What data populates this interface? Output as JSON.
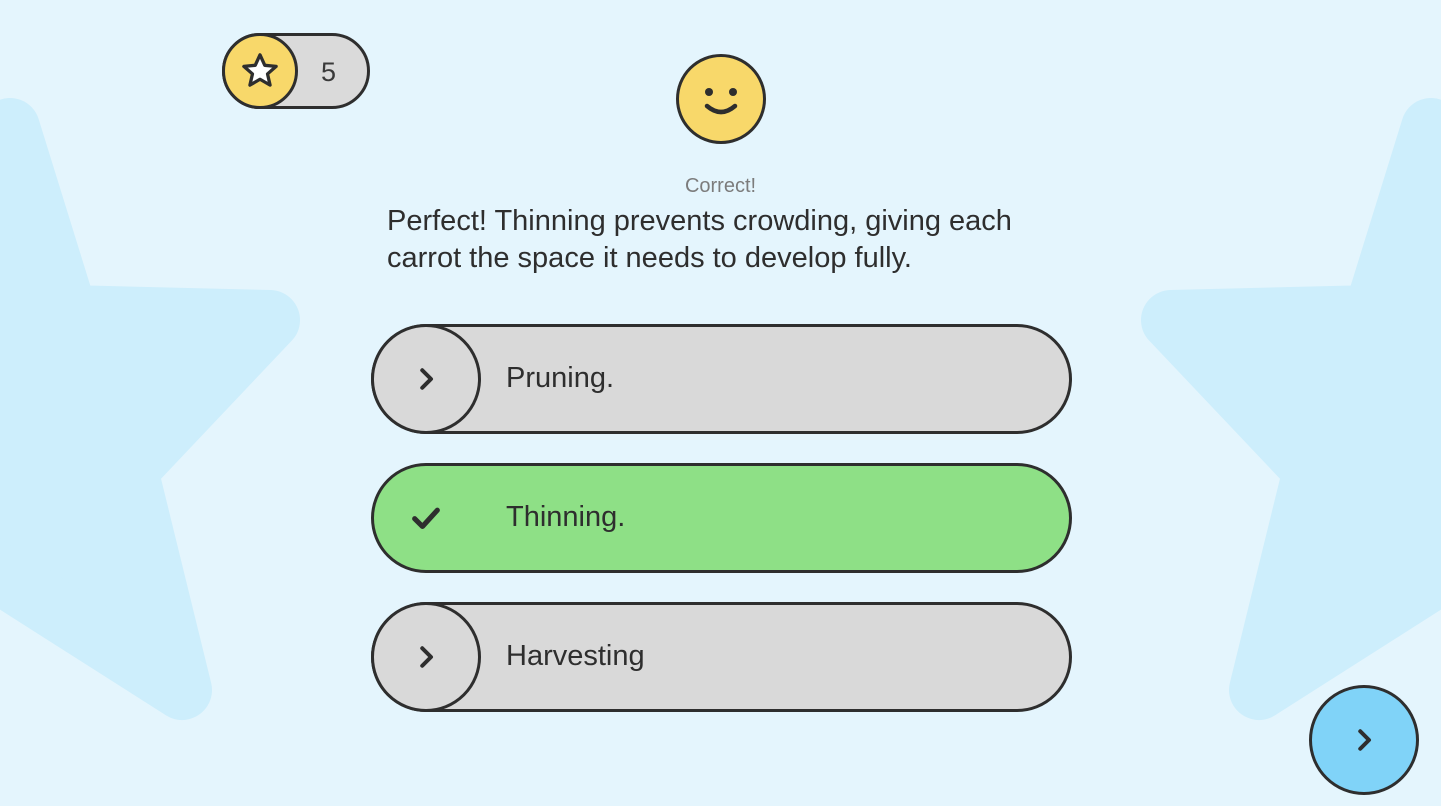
{
  "score": {
    "icon": "star-icon",
    "value": "5"
  },
  "mood": {
    "icon": "smiley-face-icon"
  },
  "status": "Correct!",
  "feedback": "Perfect! Thinning prevents crowding, giving each carrot the space it needs to develop fully.",
  "answers": [
    {
      "label": "Pruning.",
      "icon": "chevron-right-icon",
      "state": "default"
    },
    {
      "label": "Thinning.",
      "icon": "checkmark-icon",
      "state": "correct"
    },
    {
      "label": "Harvesting",
      "icon": "chevron-right-icon",
      "state": "default"
    }
  ],
  "next_button": {
    "icon": "chevron-right-icon"
  },
  "colors": {
    "background": "#e4f5fd",
    "decor_star": "#cdeefc",
    "accent_yellow": "#f8d86a",
    "correct_green": "#8ee086",
    "neutral_gray": "#d9d9d9",
    "next_blue": "#80d3f8",
    "outline": "#2e2e2e"
  }
}
